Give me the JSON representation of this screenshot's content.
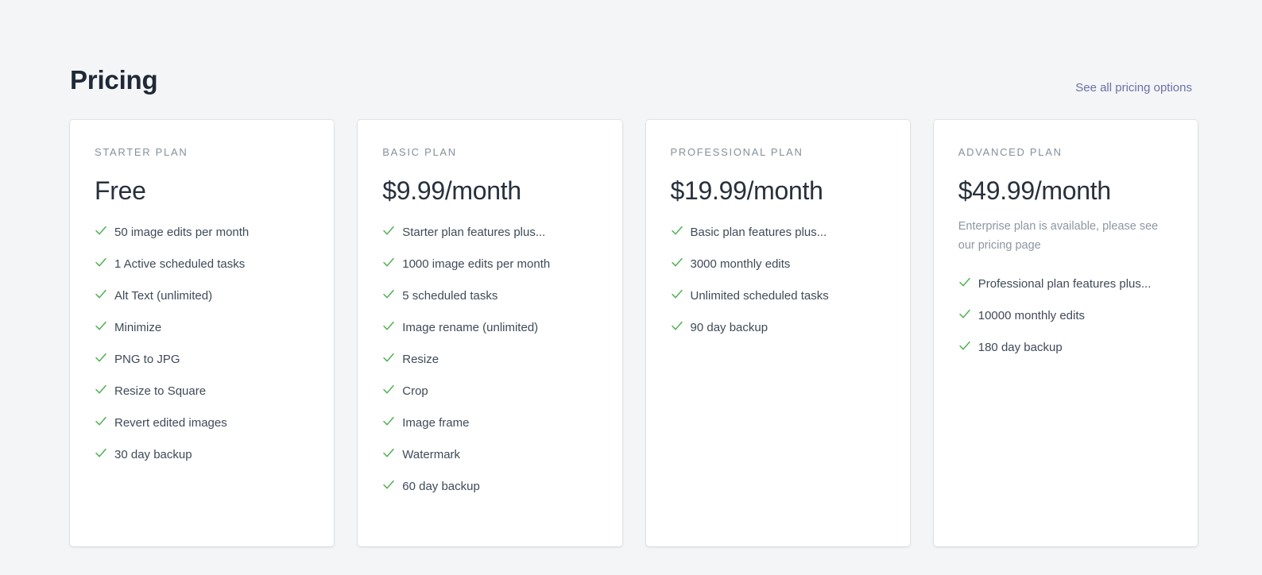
{
  "header": {
    "title": "Pricing",
    "link_label": "See all pricing options"
  },
  "theme": {
    "background": "#f4f5f7",
    "card_background": "#ffffff",
    "title_color": "#1f2937",
    "link_color": "#6b71a6",
    "plan_label_color": "#868f9b",
    "price_color": "#28313d",
    "feature_text_color": "#3f4a58",
    "note_color": "#8d96a2",
    "check_color": "#4caf50"
  },
  "icons": {
    "check": "check-icon"
  },
  "plans": [
    {
      "label": "STARTER PLAN",
      "price": "Free",
      "note": null,
      "features": [
        "50 image edits per month",
        "1 Active scheduled tasks",
        "Alt Text (unlimited)",
        "Minimize",
        "PNG to JPG",
        "Resize to Square",
        "Revert edited images",
        "30 day backup"
      ]
    },
    {
      "label": "BASIC PLAN",
      "price": "$9.99/month",
      "note": null,
      "features": [
        "Starter plan features plus...",
        "1000 image edits per month",
        "5 scheduled tasks",
        "Image rename (unlimited)",
        "Resize",
        "Crop",
        "Image frame",
        "Watermark",
        "60 day backup"
      ]
    },
    {
      "label": "PROFESSIONAL PLAN",
      "price": "$19.99/month",
      "note": null,
      "features": [
        "Basic plan features plus...",
        "3000 monthly edits",
        "Unlimited scheduled tasks",
        "90 day backup"
      ]
    },
    {
      "label": "ADVANCED PLAN",
      "price": "$49.99/month",
      "note": "Enterprise plan is available, please see our pricing page",
      "features": [
        "Professional plan features plus...",
        "10000 monthly edits",
        "180 day backup"
      ]
    }
  ]
}
